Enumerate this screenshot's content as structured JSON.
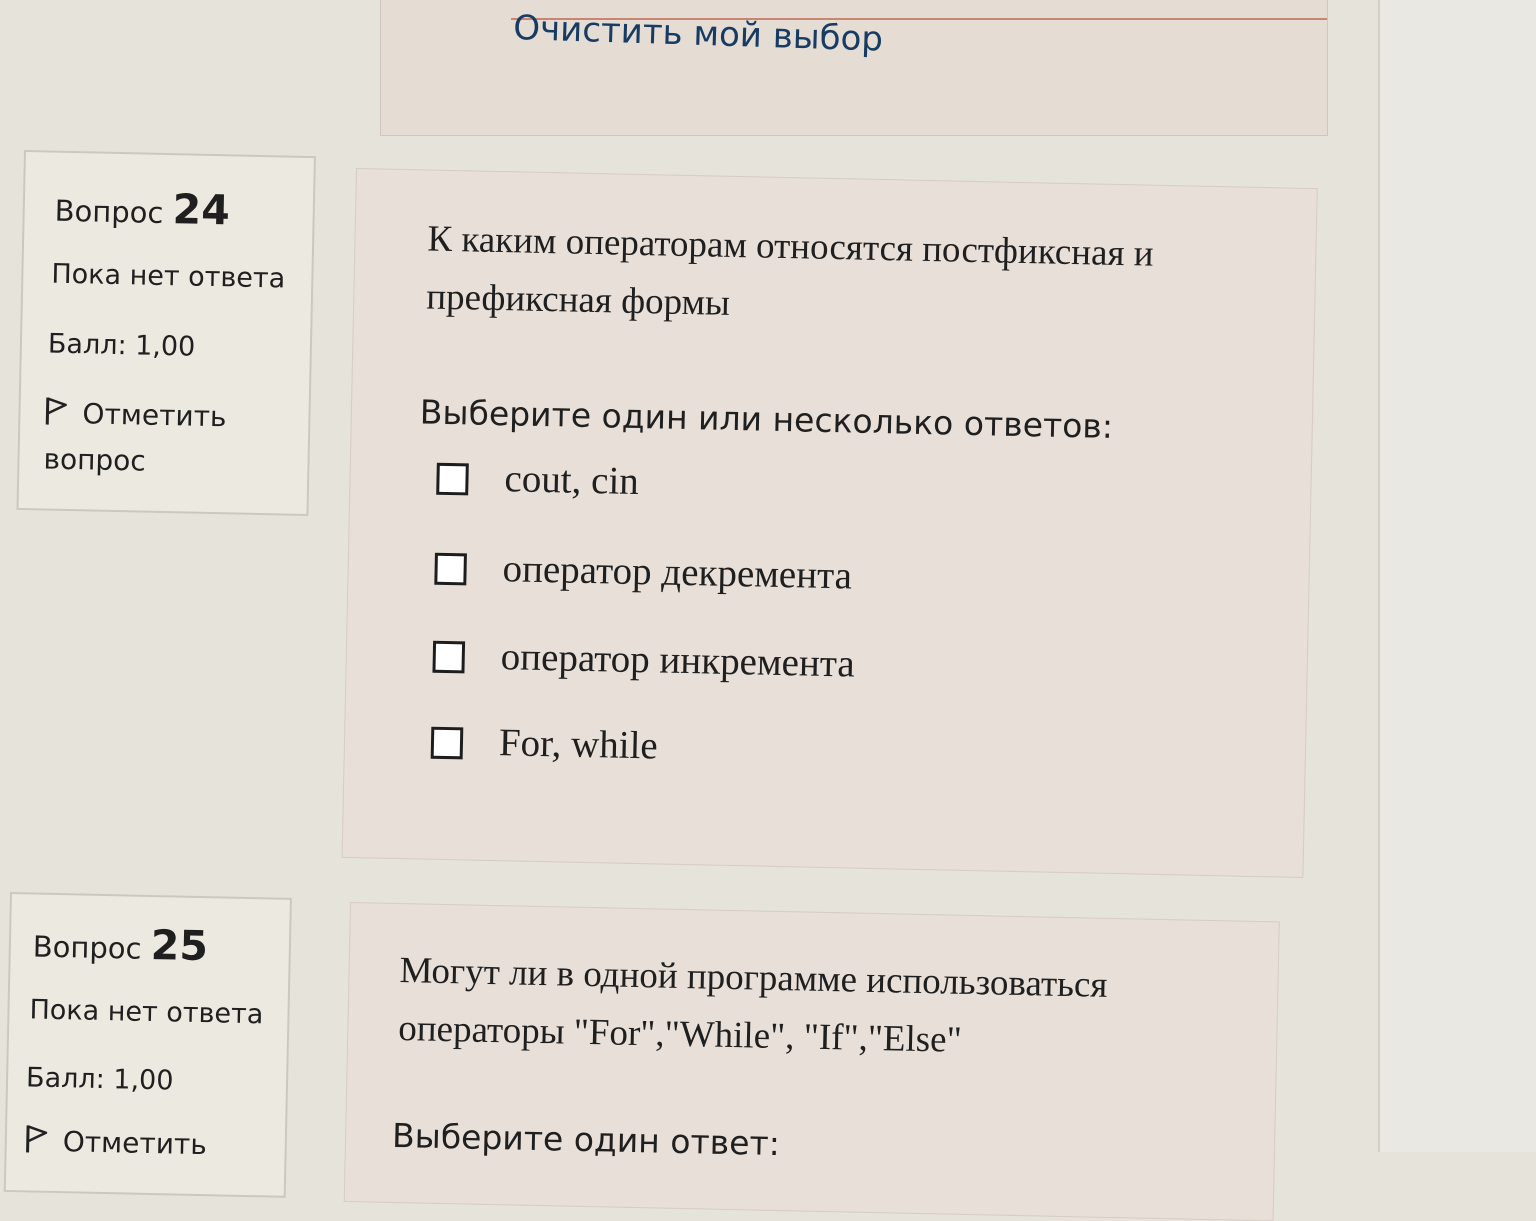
{
  "previous_question": {
    "clear_choice_link": "Очистить мой выбор"
  },
  "questions": [
    {
      "label": "Вопрос",
      "number": "24",
      "state": "Пока нет ответа",
      "grade": "Балл: 1,00",
      "flag_line1": "Отметить",
      "flag_line2": "вопрос",
      "text_line1": "К каким операторам относятся постфиксная и",
      "text_line2": "префиксная формы",
      "prompt": "Выберите один или несколько ответов:",
      "answers": [
        {
          "label": "cout, cin",
          "checked": false
        },
        {
          "label": "оператор декремента",
          "checked": false
        },
        {
          "label": "оператор инкремента",
          "checked": false
        },
        {
          "label": "For, while",
          "checked": false
        }
      ]
    },
    {
      "label": "Вопрос",
      "number": "25",
      "state": "Пока нет ответа",
      "grade": "Балл: 1,00",
      "flag_line1": "Отметить",
      "text_line1": "Могут ли в одной программе использоваться",
      "text_line2": "операторы \"For\",\"While\", \"If\",\"Else\"",
      "prompt": "Выберите один ответ:"
    }
  ],
  "icons": {
    "flag": "flag-icon",
    "checkbox": "checkbox-empty"
  },
  "colors": {
    "page_background": "#e6e3da",
    "card_background": "#e7dfd8",
    "link": "#173c63"
  }
}
